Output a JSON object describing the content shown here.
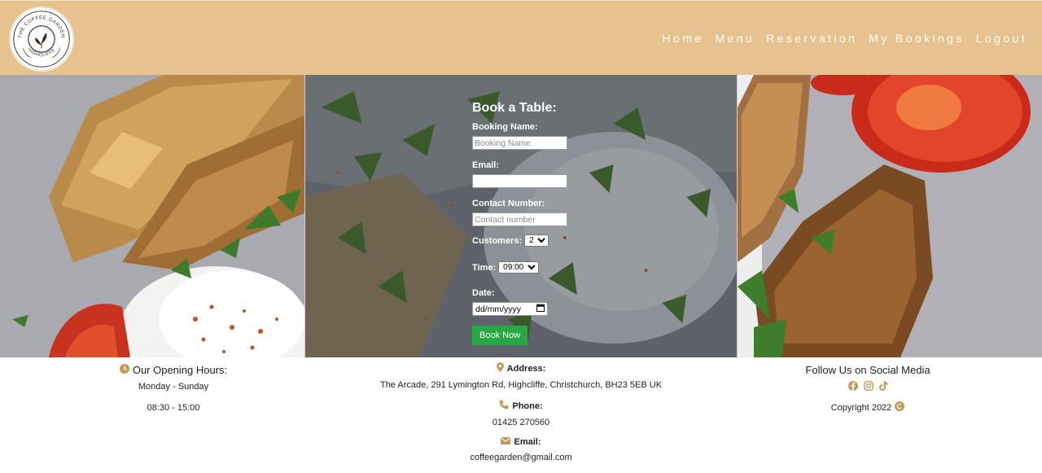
{
  "header": {
    "logo": {
      "ring_top": "THE COFFEE GARDEN",
      "ring_bottom": "HIGHCLIFFE"
    },
    "nav": [
      {
        "label": "Home"
      },
      {
        "label": "Menu"
      },
      {
        "label": "Reservation"
      },
      {
        "label": "My Bookings"
      },
      {
        "label": "Logout"
      }
    ]
  },
  "form": {
    "title": "Book a Table:",
    "booking_name": {
      "label": "Booking Name:",
      "placeholder": "Booking Name",
      "value": ""
    },
    "email": {
      "label": "Email:",
      "value": ""
    },
    "contact": {
      "label": "Contact Number:",
      "placeholder": "Contact number",
      "value": ""
    },
    "customers": {
      "label": "Customers:",
      "selected": "2"
    },
    "time": {
      "label": "Time:",
      "selected": "09:00"
    },
    "date": {
      "label": "Date:",
      "placeholder": "dd/mm/yyyy"
    },
    "submit_label": "Book Now"
  },
  "footer": {
    "hours": {
      "heading": "Our Opening Hours:",
      "days": "Monday - Sunday",
      "times": "08:30 - 15:00"
    },
    "address": {
      "label": "Address:",
      "value": "The Arcade, 291 Lymington Rd, Highcliffe, Christchurch, BH23 5EB UK"
    },
    "phone": {
      "label": "Phone:",
      "value": "01425 270560"
    },
    "email": {
      "label": "Email:",
      "value": "coffeegarden@gmail.com"
    },
    "social": {
      "heading": "Follow Us on Social Media",
      "icons": [
        "facebook-icon",
        "instagram-icon",
        "tiktok-icon"
      ]
    },
    "copyright": "Copyright 2022"
  },
  "colors": {
    "header_bg": "#e6c28f",
    "accent_gold": "#c49a5a",
    "button_green": "#28a745"
  }
}
